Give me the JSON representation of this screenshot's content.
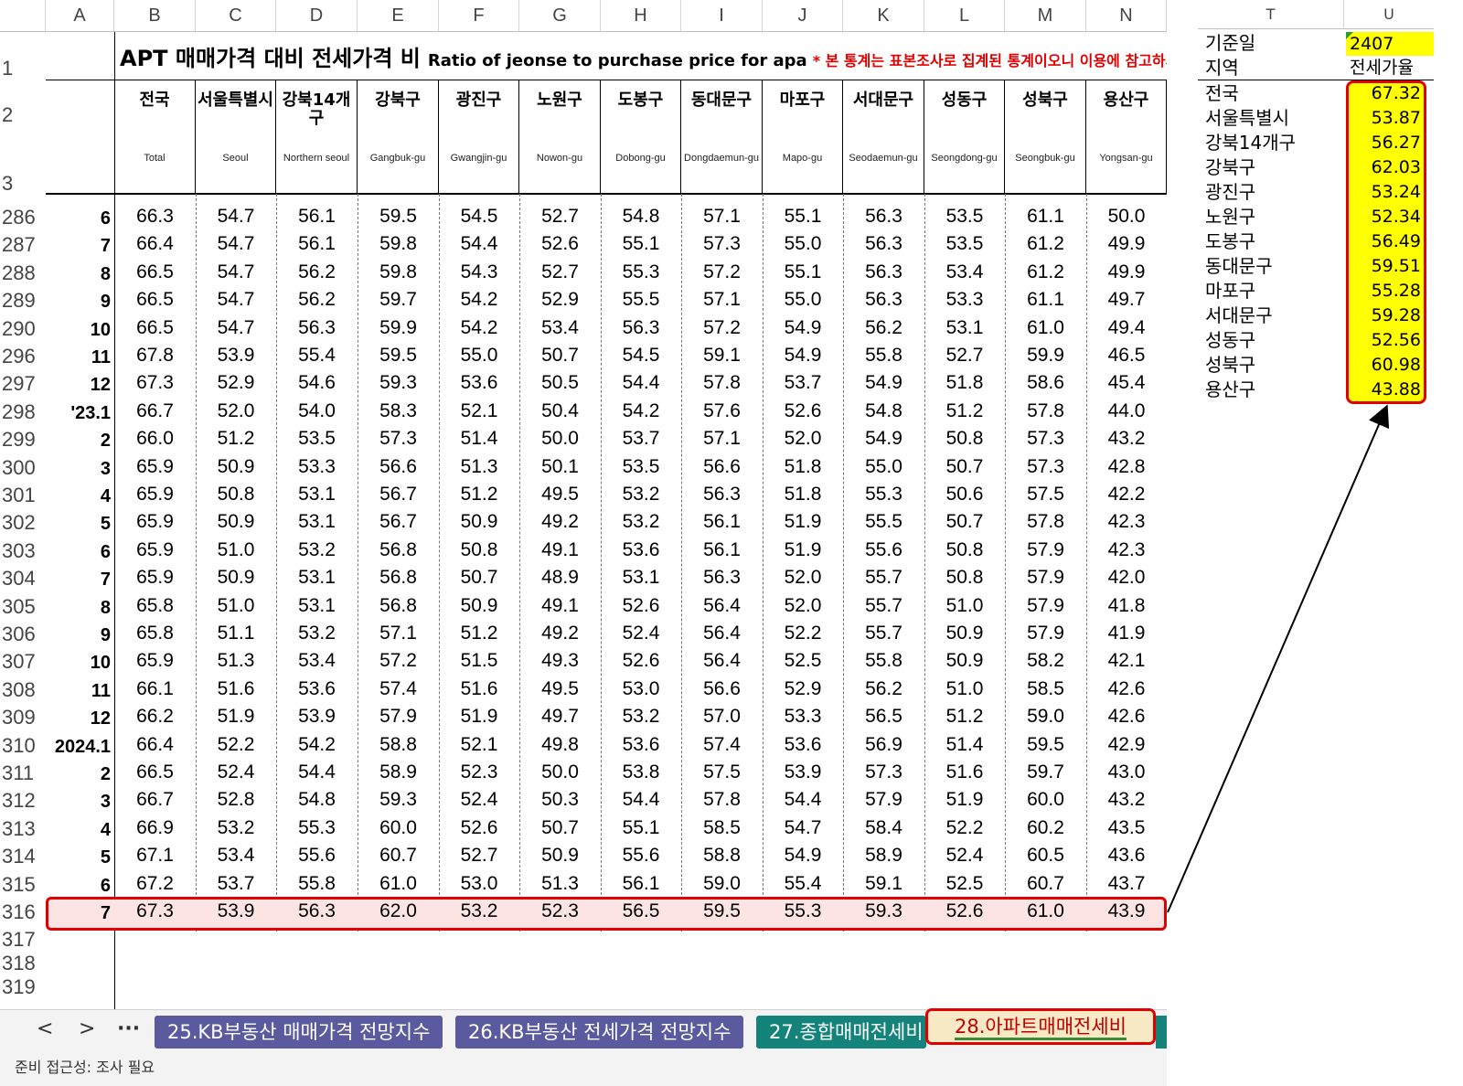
{
  "columns": [
    "A",
    "B",
    "C",
    "D",
    "E",
    "F",
    "G",
    "H",
    "I",
    "J",
    "K",
    "L",
    "M",
    "N"
  ],
  "title": {
    "ko": "APT 매매가격 대비 전세가격 비",
    "en": "Ratio of jeonse to purchase price for apa",
    "note": "* 본 통계는 표본조사로 집계된 통계이오니 이용에 참고하시기"
  },
  "header_rows": [
    "1",
    "2",
    "3"
  ],
  "regions": [
    {
      "ko": "전국",
      "en": "Total"
    },
    {
      "ko": "서울특별시",
      "en": "Seoul"
    },
    {
      "ko": "강북14개구",
      "en": "Northern seoul"
    },
    {
      "ko": "강북구",
      "en": "Gangbuk-gu"
    },
    {
      "ko": "광진구",
      "en": "Gwangjin-gu"
    },
    {
      "ko": "노원구",
      "en": "Nowon-gu"
    },
    {
      "ko": "도봉구",
      "en": "Dobong-gu"
    },
    {
      "ko": "동대문구",
      "en": "Dongdaemun-gu"
    },
    {
      "ko": "마포구",
      "en": "Mapo-gu"
    },
    {
      "ko": "서대문구",
      "en": "Seodaemun-gu"
    },
    {
      "ko": "성동구",
      "en": "Seongdong-gu"
    },
    {
      "ko": "성북구",
      "en": "Seongbuk-gu"
    },
    {
      "ko": "용산구",
      "en": "Yongsan-gu"
    }
  ],
  "rows": [
    {
      "num": "286",
      "a": "6",
      "v": [
        "66.3",
        "54.7",
        "56.1",
        "59.5",
        "54.5",
        "52.7",
        "54.8",
        "57.1",
        "55.1",
        "56.3",
        "53.5",
        "61.1",
        "50.0"
      ]
    },
    {
      "num": "287",
      "a": "7",
      "v": [
        "66.4",
        "54.7",
        "56.1",
        "59.8",
        "54.4",
        "52.6",
        "55.1",
        "57.3",
        "55.0",
        "56.3",
        "53.5",
        "61.2",
        "49.9"
      ]
    },
    {
      "num": "288",
      "a": "8",
      "v": [
        "66.5",
        "54.7",
        "56.2",
        "59.8",
        "54.3",
        "52.7",
        "55.3",
        "57.2",
        "55.1",
        "56.3",
        "53.4",
        "61.2",
        "49.9"
      ]
    },
    {
      "num": "289",
      "a": "9",
      "v": [
        "66.5",
        "54.7",
        "56.2",
        "59.7",
        "54.2",
        "52.9",
        "55.5",
        "57.1",
        "55.0",
        "56.3",
        "53.3",
        "61.1",
        "49.7"
      ]
    },
    {
      "num": "290",
      "a": "10",
      "v": [
        "66.5",
        "54.7",
        "56.3",
        "59.9",
        "54.2",
        "53.4",
        "56.3",
        "57.2",
        "54.9",
        "56.2",
        "53.1",
        "61.0",
        "49.4"
      ]
    },
    {
      "num": "296",
      "a": "11",
      "v": [
        "67.8",
        "53.9",
        "55.4",
        "59.5",
        "55.0",
        "50.7",
        "54.5",
        "59.1",
        "54.9",
        "55.8",
        "52.7",
        "59.9",
        "46.5"
      ]
    },
    {
      "num": "297",
      "a": "12",
      "v": [
        "67.3",
        "52.9",
        "54.6",
        "59.3",
        "53.6",
        "50.5",
        "54.4",
        "57.8",
        "53.7",
        "54.9",
        "51.8",
        "58.6",
        "45.4"
      ]
    },
    {
      "num": "298",
      "a": "'23.1",
      "v": [
        "66.7",
        "52.0",
        "54.0",
        "58.3",
        "52.1",
        "50.4",
        "54.2",
        "57.6",
        "52.6",
        "54.8",
        "51.2",
        "57.8",
        "44.0"
      ]
    },
    {
      "num": "299",
      "a": "2",
      "v": [
        "66.0",
        "51.2",
        "53.5",
        "57.3",
        "51.4",
        "50.0",
        "53.7",
        "57.1",
        "52.0",
        "54.9",
        "50.8",
        "57.3",
        "43.2"
      ]
    },
    {
      "num": "300",
      "a": "3",
      "v": [
        "65.9",
        "50.9",
        "53.3",
        "56.6",
        "51.3",
        "50.1",
        "53.5",
        "56.6",
        "51.8",
        "55.0",
        "50.7",
        "57.3",
        "42.8"
      ]
    },
    {
      "num": "301",
      "a": "4",
      "v": [
        "65.9",
        "50.8",
        "53.1",
        "56.7",
        "51.2",
        "49.5",
        "53.2",
        "56.3",
        "51.8",
        "55.3",
        "50.6",
        "57.5",
        "42.2"
      ]
    },
    {
      "num": "302",
      "a": "5",
      "v": [
        "65.9",
        "50.9",
        "53.1",
        "56.7",
        "50.9",
        "49.2",
        "53.2",
        "56.1",
        "51.9",
        "55.5",
        "50.7",
        "57.8",
        "42.3"
      ]
    },
    {
      "num": "303",
      "a": "6",
      "v": [
        "65.9",
        "51.0",
        "53.2",
        "56.8",
        "50.8",
        "49.1",
        "53.6",
        "56.1",
        "51.9",
        "55.6",
        "50.8",
        "57.9",
        "42.3"
      ]
    },
    {
      "num": "304",
      "a": "7",
      "v": [
        "65.9",
        "50.9",
        "53.1",
        "56.8",
        "50.7",
        "48.9",
        "53.1",
        "56.3",
        "52.0",
        "55.7",
        "50.8",
        "57.9",
        "42.0"
      ]
    },
    {
      "num": "305",
      "a": "8",
      "v": [
        "65.8",
        "51.0",
        "53.1",
        "56.8",
        "50.9",
        "49.1",
        "52.6",
        "56.4",
        "52.0",
        "55.7",
        "51.0",
        "57.9",
        "41.8"
      ]
    },
    {
      "num": "306",
      "a": "9",
      "v": [
        "65.8",
        "51.1",
        "53.2",
        "57.1",
        "51.2",
        "49.2",
        "52.4",
        "56.4",
        "52.2",
        "55.7",
        "50.9",
        "57.9",
        "41.9"
      ]
    },
    {
      "num": "307",
      "a": "10",
      "v": [
        "65.9",
        "51.3",
        "53.4",
        "57.2",
        "51.5",
        "49.3",
        "52.6",
        "56.4",
        "52.5",
        "55.8",
        "50.9",
        "58.2",
        "42.1"
      ]
    },
    {
      "num": "308",
      "a": "11",
      "v": [
        "66.1",
        "51.6",
        "53.6",
        "57.4",
        "51.6",
        "49.5",
        "53.0",
        "56.6",
        "52.9",
        "56.2",
        "51.0",
        "58.5",
        "42.6"
      ]
    },
    {
      "num": "309",
      "a": "12",
      "v": [
        "66.2",
        "51.9",
        "53.9",
        "57.9",
        "51.9",
        "49.7",
        "53.2",
        "57.0",
        "53.3",
        "56.5",
        "51.2",
        "59.0",
        "42.6"
      ]
    },
    {
      "num": "310",
      "a": "2024.1",
      "v": [
        "66.4",
        "52.2",
        "54.2",
        "58.8",
        "52.1",
        "49.8",
        "53.6",
        "57.4",
        "53.6",
        "56.9",
        "51.4",
        "59.5",
        "42.9"
      ]
    },
    {
      "num": "311",
      "a": "2",
      "v": [
        "66.5",
        "52.4",
        "54.4",
        "58.9",
        "52.3",
        "50.0",
        "53.8",
        "57.5",
        "53.9",
        "57.3",
        "51.6",
        "59.7",
        "43.0"
      ]
    },
    {
      "num": "312",
      "a": "3",
      "v": [
        "66.7",
        "52.8",
        "54.8",
        "59.3",
        "52.4",
        "50.3",
        "54.4",
        "57.8",
        "54.4",
        "57.9",
        "51.9",
        "60.0",
        "43.2"
      ]
    },
    {
      "num": "313",
      "a": "4",
      "v": [
        "66.9",
        "53.2",
        "55.3",
        "60.0",
        "52.6",
        "50.7",
        "55.1",
        "58.5",
        "54.7",
        "58.4",
        "52.2",
        "60.2",
        "43.5"
      ]
    },
    {
      "num": "314",
      "a": "5",
      "v": [
        "67.1",
        "53.4",
        "55.6",
        "60.7",
        "52.7",
        "50.9",
        "55.6",
        "58.8",
        "54.9",
        "58.9",
        "52.4",
        "60.5",
        "43.6"
      ]
    },
    {
      "num": "315",
      "a": "6",
      "v": [
        "67.2",
        "53.7",
        "55.8",
        "61.0",
        "53.0",
        "51.3",
        "56.1",
        "59.0",
        "55.4",
        "59.1",
        "52.5",
        "60.7",
        "43.7"
      ]
    },
    {
      "num": "316",
      "a": "7",
      "v": [
        "67.3",
        "53.9",
        "56.3",
        "62.0",
        "53.2",
        "52.3",
        "56.5",
        "59.5",
        "55.3",
        "59.3",
        "52.6",
        "61.0",
        "43.9"
      ]
    }
  ],
  "empty_rows": [
    "317",
    "318",
    "319"
  ],
  "tabs": {
    "nav_prev": "<",
    "nav_next": ">",
    "nav_more": "···",
    "tab25": "25.KB부동산 매매가격 전망지수",
    "tab26": "26.KB부동산 전세가격 전망지수",
    "tab27": "27.종합매매전세비",
    "tab28": "28.아파트매매전세비"
  },
  "status_text": "준비    접근성: 조사 필요",
  "right_panel": {
    "col_t": "T",
    "col_u": "U",
    "base_label": "기준일",
    "base_value": "2407",
    "region_label": "지역",
    "value_header": "전세가율",
    "items": [
      {
        "name": "전국",
        "value": "67.32"
      },
      {
        "name": "서울특별시",
        "value": "53.87"
      },
      {
        "name": "강북14개구",
        "value": "56.27"
      },
      {
        "name": "강북구",
        "value": "62.03"
      },
      {
        "name": "광진구",
        "value": "53.24"
      },
      {
        "name": "노원구",
        "value": "52.34"
      },
      {
        "name": "도봉구",
        "value": "56.49"
      },
      {
        "name": "동대문구",
        "value": "59.51"
      },
      {
        "name": "마포구",
        "value": "55.28"
      },
      {
        "name": "서대문구",
        "value": "59.28"
      },
      {
        "name": "성동구",
        "value": "52.56"
      },
      {
        "name": "성북구",
        "value": "60.98"
      },
      {
        "name": "용산구",
        "value": "43.88"
      }
    ]
  },
  "colors": {
    "highlight": "#e00000",
    "yellow": "#ffff00",
    "tab_purple": "#5b5a9e",
    "tab_teal": "#14837a"
  }
}
